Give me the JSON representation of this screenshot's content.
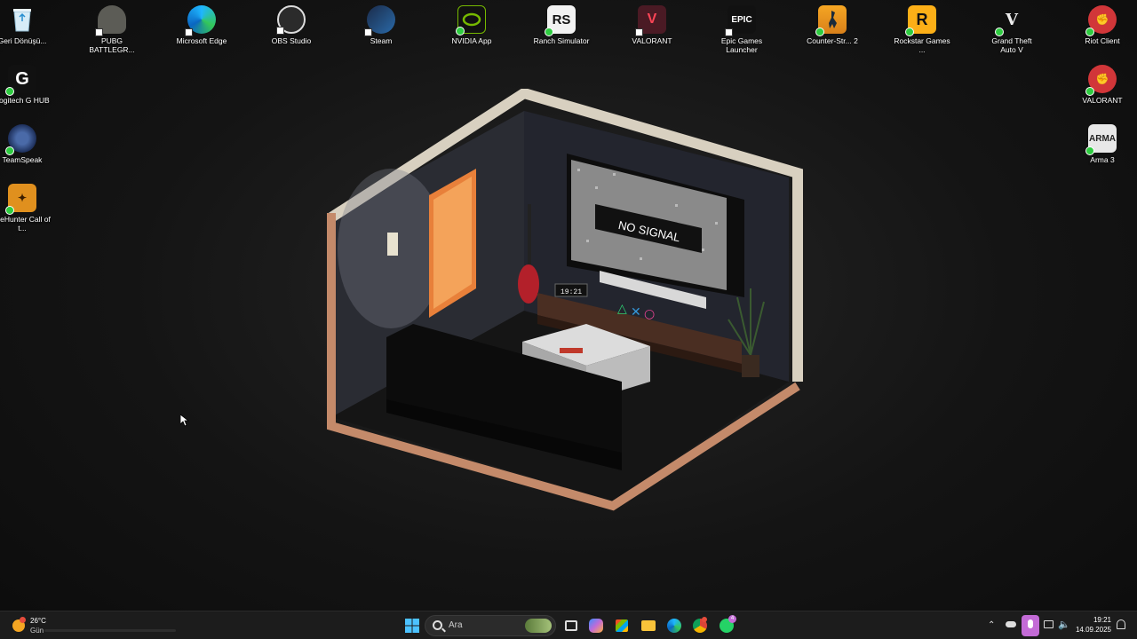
{
  "desktop": {
    "icons_left": [
      {
        "label": "Geri Dönüşü...",
        "icon": "recycle-bin-icon"
      },
      {
        "label": "Logitech G HUB",
        "icon": "logitech-g-icon"
      },
      {
        "label": "TeamSpeak",
        "icon": "teamspeak-icon"
      },
      {
        "label": "theHunter Call of t...",
        "icon": "thehunter-icon"
      }
    ],
    "icons_top": [
      {
        "label": "PUBG BATTLEGR...",
        "icon": "pubg-icon"
      },
      {
        "label": "Microsoft Edge",
        "icon": "edge-icon"
      },
      {
        "label": "OBS Studio",
        "icon": "obs-icon"
      },
      {
        "label": "Steam",
        "icon": "steam-icon"
      },
      {
        "label": "NVIDIA App",
        "icon": "nvidia-icon"
      },
      {
        "label": "Ranch Simulator",
        "icon": "ranch-simulator-icon"
      },
      {
        "label": "VALORANT",
        "icon": "valorant-icon"
      },
      {
        "label": "Epic Games Launcher",
        "icon": "epic-games-icon"
      },
      {
        "label": "Counter-Str... 2",
        "icon": "counter-strike-icon"
      },
      {
        "label": "Rockstar Games ...",
        "icon": "rockstar-icon"
      },
      {
        "label": "Grand Theft Auto V",
        "icon": "gta-v-icon"
      },
      {
        "label": "Riot Client",
        "icon": "riot-client-icon"
      }
    ],
    "icons_right": [
      {
        "label": "VALORANT",
        "icon": "riot-valorant-icon"
      },
      {
        "label": "Arma 3",
        "icon": "arma-3-icon"
      }
    ],
    "wallpaper": {
      "tv_text": "NO SIGNAL",
      "clock_text": "19:21"
    }
  },
  "taskbar": {
    "weather": {
      "temp": "26°C",
      "desc": "Gün"
    },
    "search_placeholder": "Ara",
    "apps": [
      "start-icon",
      "task-view-icon",
      "copilot-icon",
      "store-icon",
      "file-explorer-icon",
      "edge-icon",
      "chrome-icon",
      "whatsapp-icon"
    ],
    "tray": {
      "time": "19:21",
      "date": "14.09.2025"
    },
    "whatsapp_badge": "4"
  },
  "colors": {
    "taskbar_bg": "#1c1c1c",
    "accent": "#c36bd6",
    "valorant_red": "#fd4556"
  }
}
